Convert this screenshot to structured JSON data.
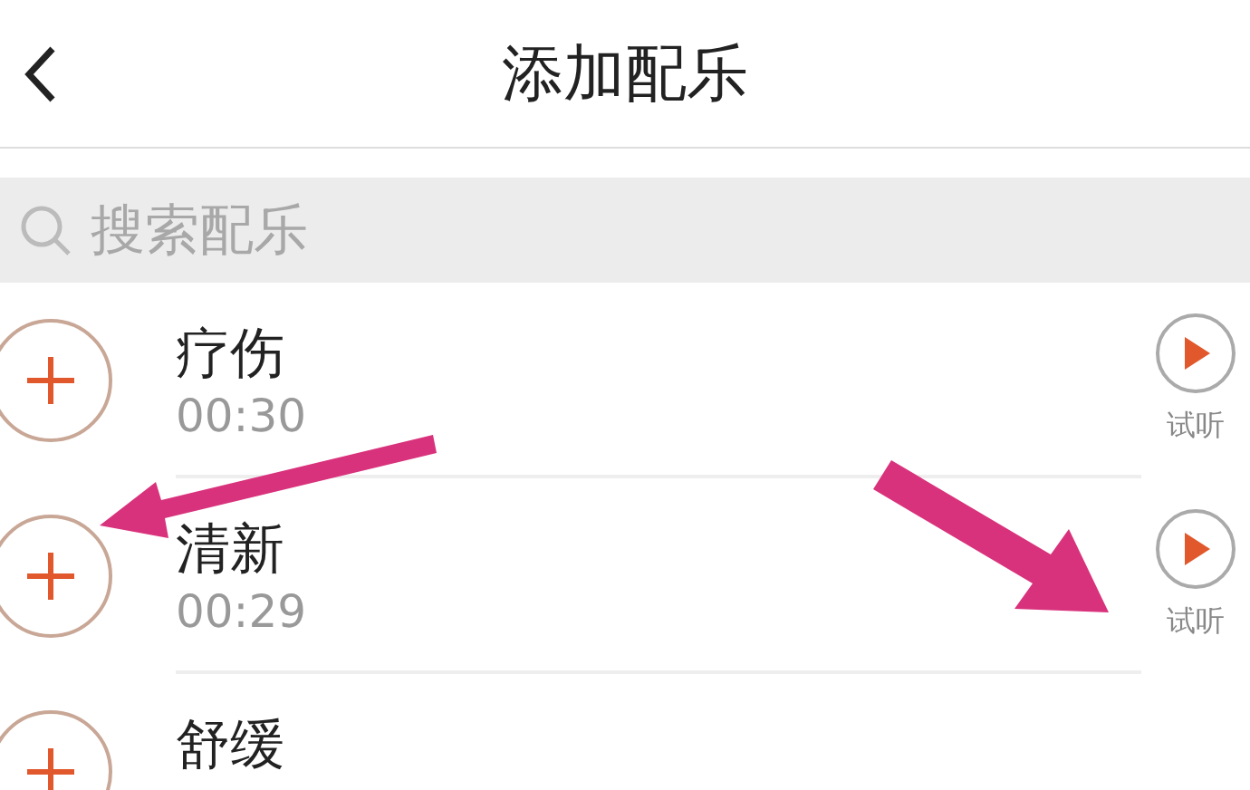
{
  "header": {
    "title": "添加配乐"
  },
  "search": {
    "placeholder": "搜索配乐"
  },
  "tracks": [
    {
      "title": "疗伤",
      "duration": "00:30",
      "preview_label": "试听"
    },
    {
      "title": "清新",
      "duration": "00:29",
      "preview_label": "试听"
    },
    {
      "title": "舒缓"
    }
  ]
}
